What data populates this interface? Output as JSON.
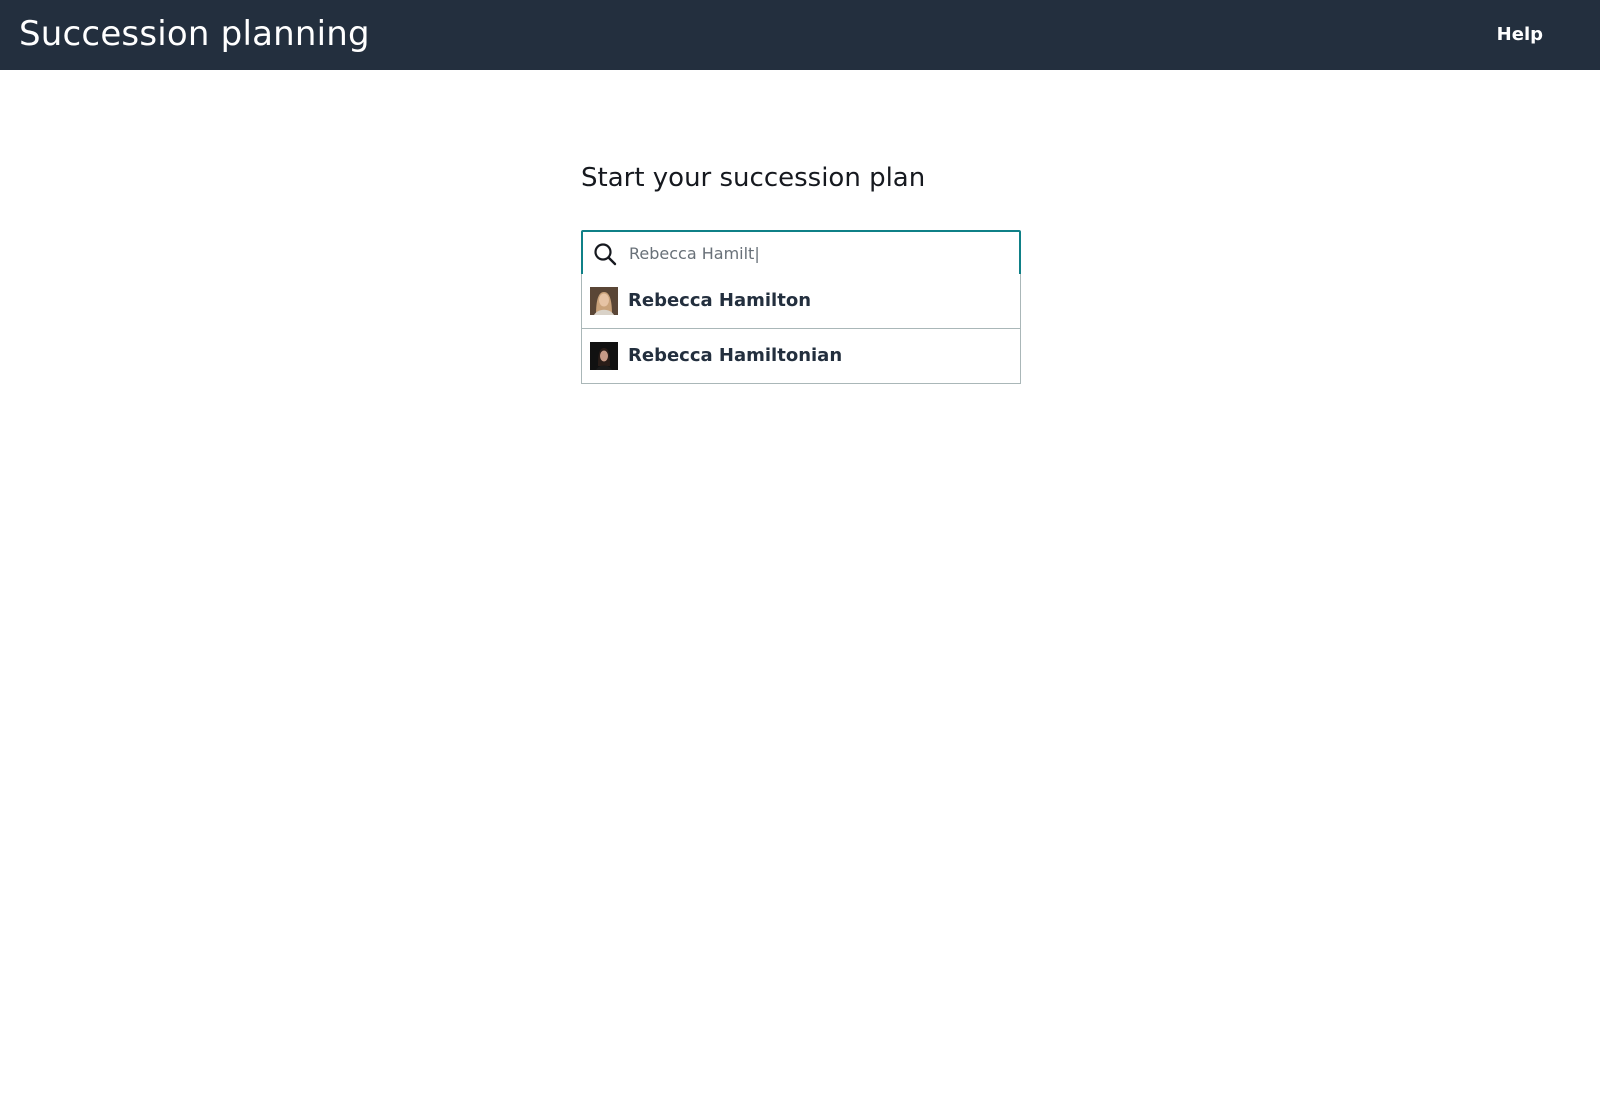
{
  "header": {
    "title": "Succession planning",
    "help_label": "Help",
    "background_color": "#232f3e"
  },
  "main": {
    "heading": "Start your succession plan",
    "search": {
      "icon": "search-icon",
      "value": "Rebecca Hamilt|",
      "accent_color": "#0f8087"
    },
    "suggestions": [
      {
        "name": "Rebecca Hamilton",
        "avatar": "avatar-photo-light-background"
      },
      {
        "name": "Rebecca Hamiltonian",
        "avatar": "avatar-photo-dark-background"
      }
    ]
  }
}
